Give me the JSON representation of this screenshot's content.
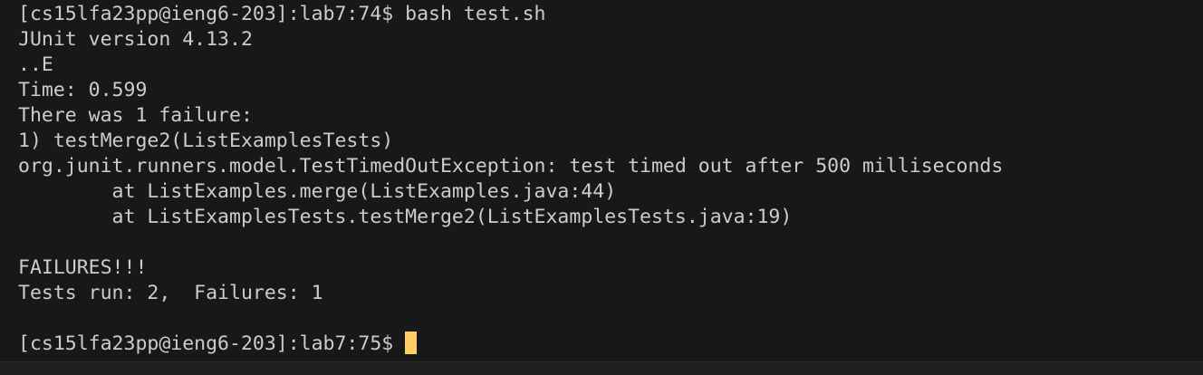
{
  "terminal": {
    "lines": [
      "[cs15lfa23pp@ieng6-203]:lab7:74$ bash test.sh",
      "JUnit version 4.13.2",
      "..E",
      "Time: 0.599",
      "There was 1 failure:",
      "1) testMerge2(ListExamplesTests)",
      "org.junit.runners.model.TestTimedOutException: test timed out after 500 milliseconds",
      "        at ListExamples.merge(ListExamples.java:44)",
      "        at ListExamplesTests.testMerge2(ListExamplesTests.java:19)",
      "",
      "FAILURES!!!",
      "Tests run: 2,  Failures: 1",
      "",
      "[cs15lfa23pp@ieng6-203]:lab7:75$ "
    ]
  },
  "colors": {
    "background": "#181818",
    "text": "#cccccc",
    "cursor": "#ffcc66"
  }
}
